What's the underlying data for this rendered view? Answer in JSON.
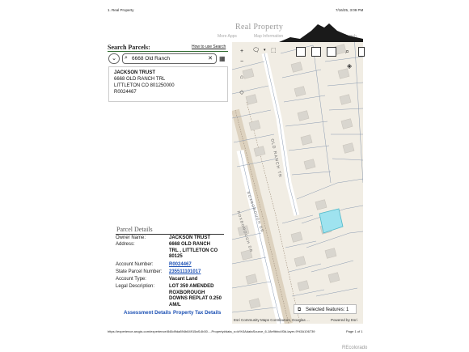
{
  "print_header": {
    "title": "1. Real Property",
    "datetime": "7/16/25, 3:09 PM"
  },
  "banner": {
    "title": "Real Property",
    "links": [
      "More Apps",
      "Map Information",
      "Search"
    ]
  },
  "search_panel": {
    "title": "Search Parcels:",
    "help_link": "How to use Search",
    "search_value": "6668 Old Ranch",
    "result": {
      "owner": "JACKSON TRUST",
      "address_line1": "6668 OLD RANCH TRL",
      "address_line2": "LITTLETON  CO  801250000",
      "account": "R0024467"
    }
  },
  "parcel_details": {
    "title": "Parcel Details",
    "rows": [
      {
        "label": "Owner Name:",
        "value": "JACKSON TRUST"
      },
      {
        "label": "Address:",
        "value": "6668 OLD RANCH TRL , LITTLETON CO 80125"
      },
      {
        "label": "Account Number:",
        "value": "R0024467"
      },
      {
        "label": "State Parcel Number:",
        "value": "235511101017"
      },
      {
        "label": "Account Type:",
        "value": "Vacant Land"
      },
      {
        "label": "Legal Description:",
        "value": "LOT 359 AMENDED ROXBOROUGH DOWNS REPLAT 0.250 AM/L"
      }
    ],
    "assessment_link": "Assessment Details",
    "tax_link": "Property Tax Details"
  },
  "map": {
    "street_labels": [
      "OLD RANCH TR",
      "ROXBOROUGH DR",
      "ROXBOROUGH DR"
    ],
    "selected_features": "Selected features: 1",
    "attribution": "Esri Community Maps Contributors, Douglas ...",
    "powered_by": "Powered by Esri"
  },
  "print_footer": {
    "url": "https://experience.arcgis.com/experience/846d9da894b84915af14b30...-Property#data_s=id%3AdataSource_6-18e9bbc4f3d-layer-9%3A106739",
    "page": "Page 1 of 1"
  },
  "watermark": "REcolorado",
  "colors": {
    "parcel_lines": "#8a9ab0",
    "selected_parcel": "#9fe3ef",
    "search_rule": "#2f6b2f",
    "link": "#1a4fb4"
  }
}
